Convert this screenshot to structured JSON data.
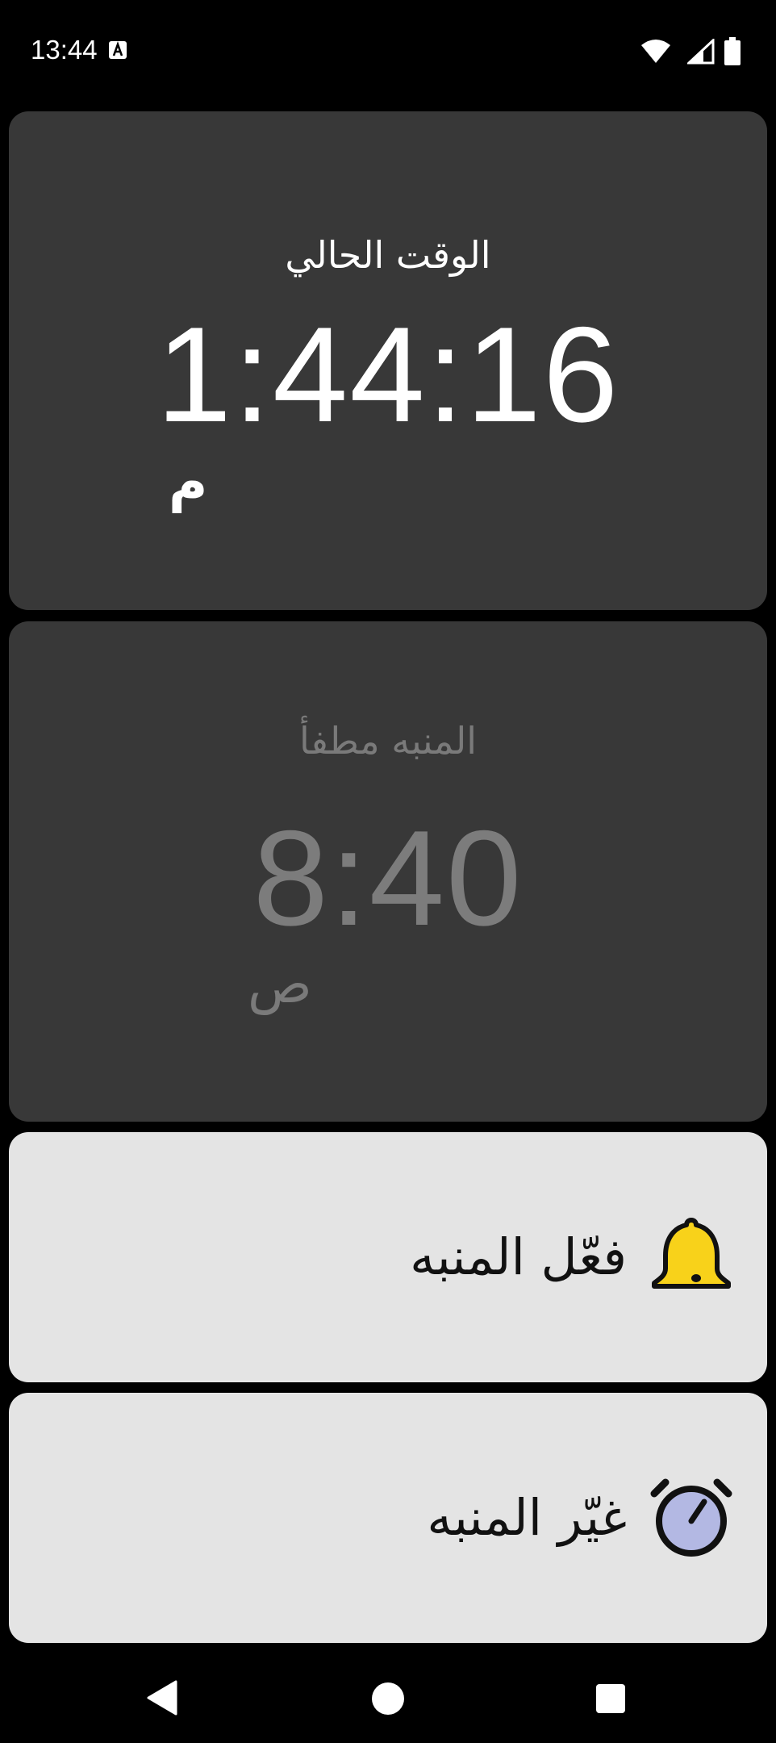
{
  "status_bar": {
    "time": "13:44",
    "icons": [
      "text-a-icon",
      "wifi-icon",
      "signal-icon",
      "battery-icon"
    ]
  },
  "current_time_card": {
    "heading": "الوقت الحالي",
    "time": "1:44:16",
    "period": "م"
  },
  "alarm_card": {
    "heading": "المنبه مطفأ",
    "time": "8:40",
    "period": "ص"
  },
  "actions": {
    "enable_label": "فعّل المنبه",
    "enable_icon": "bell-icon",
    "change_label": "غيّر المنبه",
    "change_icon": "alarm-clock-icon"
  },
  "colors": {
    "background": "#000000",
    "card_dark": "#383838",
    "card_light": "#e4e4e4",
    "bell_yellow": "#f8d21a",
    "clock_face": "#b3b8e3",
    "disabled_text": "#7a7a7a"
  },
  "nav_bar": {
    "icons": [
      "back-icon",
      "home-icon",
      "recents-icon"
    ]
  }
}
